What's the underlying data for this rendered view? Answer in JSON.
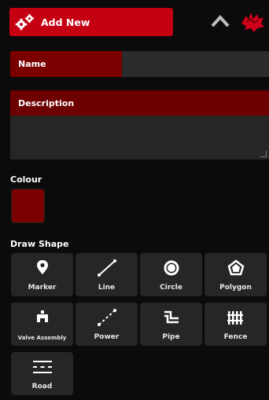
{
  "header": {
    "title": "Add New",
    "accent": "#c40012",
    "icons": [
      "gears-icon",
      "chevron-up-icon",
      "brand-logo-icon"
    ]
  },
  "form": {
    "name_label": "Name",
    "description_label": "Description",
    "colour_label": "Colour",
    "colour_value": "#7a0000"
  },
  "draw_shape": {
    "label": "Draw Shape",
    "tools": [
      {
        "label": "Marker",
        "icon": "marker-pin-icon"
      },
      {
        "label": "Line",
        "icon": "line-icon"
      },
      {
        "label": "Circle",
        "icon": "circle-icon"
      },
      {
        "label": "Polygon",
        "icon": "polygon-icon"
      },
      {
        "label": "Valve Assembly",
        "icon": "valve-icon"
      },
      {
        "label": "Power",
        "icon": "power-line-icon"
      },
      {
        "label": "Pipe",
        "icon": "pipe-icon"
      },
      {
        "label": "Fence",
        "icon": "fence-icon"
      },
      {
        "label": "Road",
        "icon": "road-icon"
      }
    ]
  }
}
